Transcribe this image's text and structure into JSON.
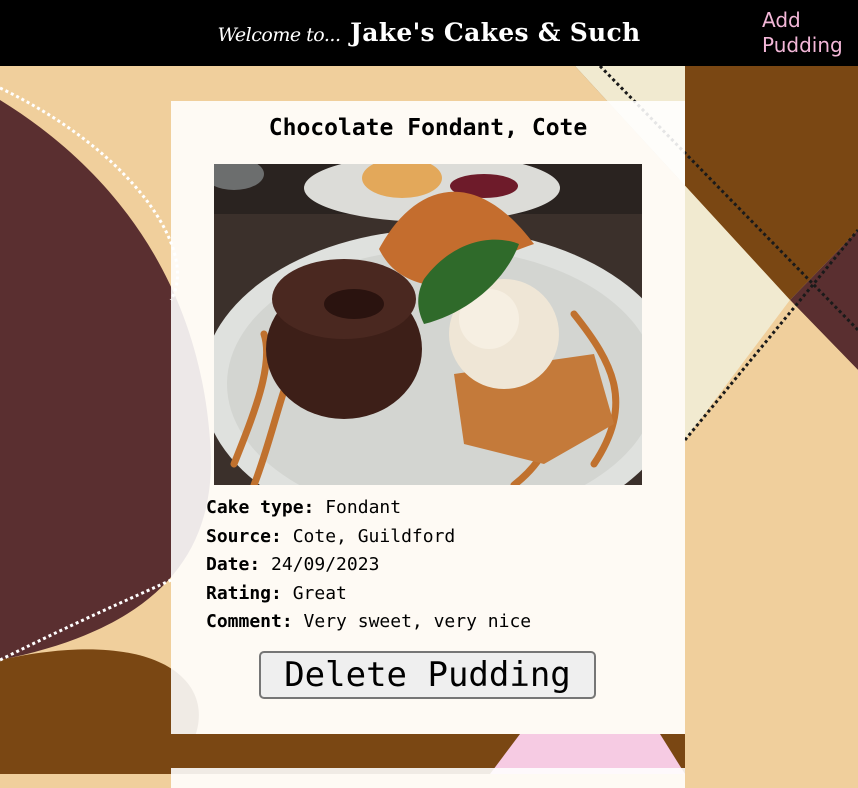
{
  "header": {
    "welcome_prefix": "Welcome to...",
    "site_name": "Jake's Cakes & Such",
    "add_link": "Add Pudding"
  },
  "colors": {
    "header_bg": "#000000",
    "add_link": "#f3b7d8",
    "background_tan": "#f0cf9c",
    "background_brown": "#7a4713",
    "background_maroon": "#5a2f30",
    "background_cream": "#f1ead0",
    "background_pink": "#f6cbe3"
  },
  "pudding": {
    "title": "Chocolate Fondant, Cote",
    "photo": "chocolate-fondant-with-ice-cream",
    "fields": [
      {
        "label": "Cake type:",
        "value": "Fondant"
      },
      {
        "label": "Source:",
        "value": "Cote, Guildford"
      },
      {
        "label": "Date:",
        "value": "24/09/2023"
      },
      {
        "label": "Rating:",
        "value": "Great"
      },
      {
        "label": "Comment:",
        "value": "Very sweet, very nice"
      }
    ],
    "delete_label": "Delete Pudding"
  }
}
